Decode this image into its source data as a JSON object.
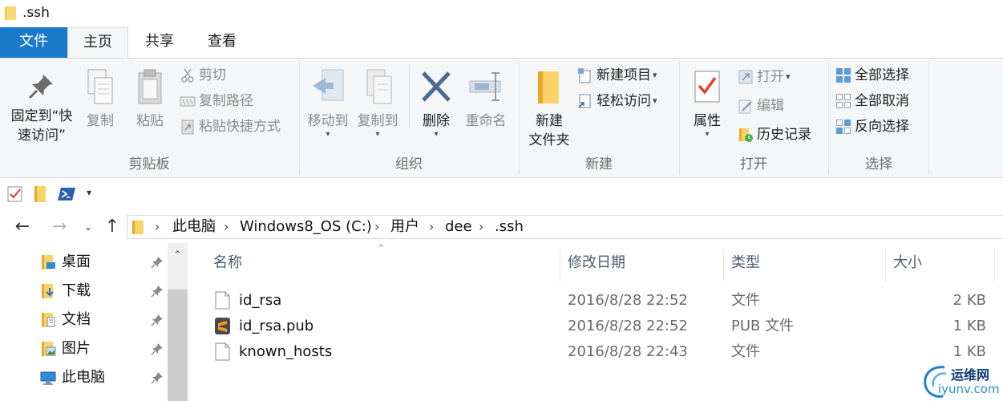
{
  "window": {
    "title": ".ssh"
  },
  "tabs": [
    {
      "label": "文件"
    },
    {
      "label": "主页"
    },
    {
      "label": "共享"
    },
    {
      "label": "查看"
    }
  ],
  "ribbon": {
    "clipboard": {
      "label": "剪贴板",
      "pin_line1": "固定到“快",
      "pin_line2": "速访问”",
      "copy": "复制",
      "paste": "粘贴",
      "cut": "剪切",
      "copy_path": "复制路径",
      "paste_shortcut": "粘贴快捷方式"
    },
    "organize": {
      "label": "组织",
      "move_to": "移动到",
      "copy_to": "复制到",
      "delete": "删除",
      "rename": "重命名"
    },
    "new": {
      "label": "新建",
      "new_folder_line1": "新建",
      "new_folder_line2": "文件夹",
      "new_item": "新建项目",
      "easy_access": "轻松访问"
    },
    "open": {
      "label": "打开",
      "properties": "属性",
      "open": "打开",
      "edit": "编辑",
      "history": "历史记录"
    },
    "select": {
      "label": "选择",
      "select_all": "全部选择",
      "select_none": "全部取消",
      "invert": "反向选择"
    }
  },
  "breadcrumb": [
    "此电脑",
    "Windows8_OS (C:)",
    "用户",
    "dee",
    ".ssh"
  ],
  "sidebar": {
    "items": [
      {
        "label": "桌面",
        "icon": "desktop-folder-icon"
      },
      {
        "label": "下载",
        "icon": "downloads-folder-icon"
      },
      {
        "label": "文档",
        "icon": "documents-folder-icon"
      },
      {
        "label": "图片",
        "icon": "pictures-folder-icon"
      },
      {
        "label": "此电脑",
        "icon": "this-pc-icon"
      }
    ]
  },
  "columns": {
    "name": "名称",
    "date": "修改日期",
    "type": "类型",
    "size": "大小"
  },
  "files": [
    {
      "name": "id_rsa",
      "date": "2016/8/28 22:52",
      "type": "文件",
      "size": "2 KB",
      "icon": "blank-file-icon"
    },
    {
      "name": "id_rsa.pub",
      "date": "2016/8/28 22:52",
      "type": "PUB 文件",
      "size": "1 KB",
      "icon": "sublime-file-icon"
    },
    {
      "name": "known_hosts",
      "date": "2016/8/28 22:43",
      "type": "文件",
      "size": "1 KB",
      "icon": "blank-file-icon"
    }
  ],
  "watermark": {
    "line1": "运维网",
    "line2": "iyunv.com"
  },
  "colors": {
    "accent": "#1979ca",
    "ribbon_bg": "#f5f6f7",
    "folder": "#f5c242"
  }
}
